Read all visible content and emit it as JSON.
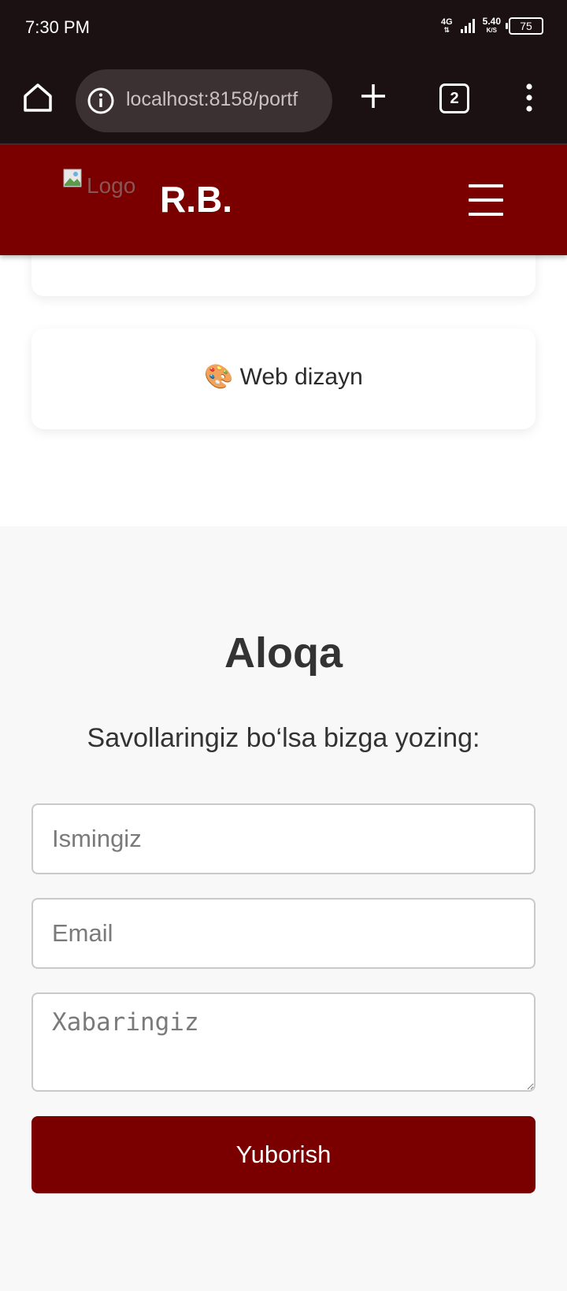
{
  "status_bar": {
    "time": "7:30 PM",
    "network": "4G",
    "speed_value": "5.40",
    "speed_unit": "K/S",
    "battery": "75"
  },
  "browser": {
    "url": "localhost:8158/portf",
    "tab_count": "2"
  },
  "site_header": {
    "logo_alt": "Logo",
    "brand": "R.B."
  },
  "services": {
    "web_design_emoji": "🎨",
    "web_design": "Web dizayn"
  },
  "contact": {
    "title": "Aloqa",
    "subtitle": "Savollaringiz bo‘lsa bizga yozing:",
    "name_placeholder": "Ismingiz",
    "email_placeholder": "Email",
    "message_placeholder": "Xabaringiz",
    "submit_label": "Yuborish"
  },
  "colors": {
    "brand": "#7a0000",
    "browser_bg": "#1b1113"
  }
}
